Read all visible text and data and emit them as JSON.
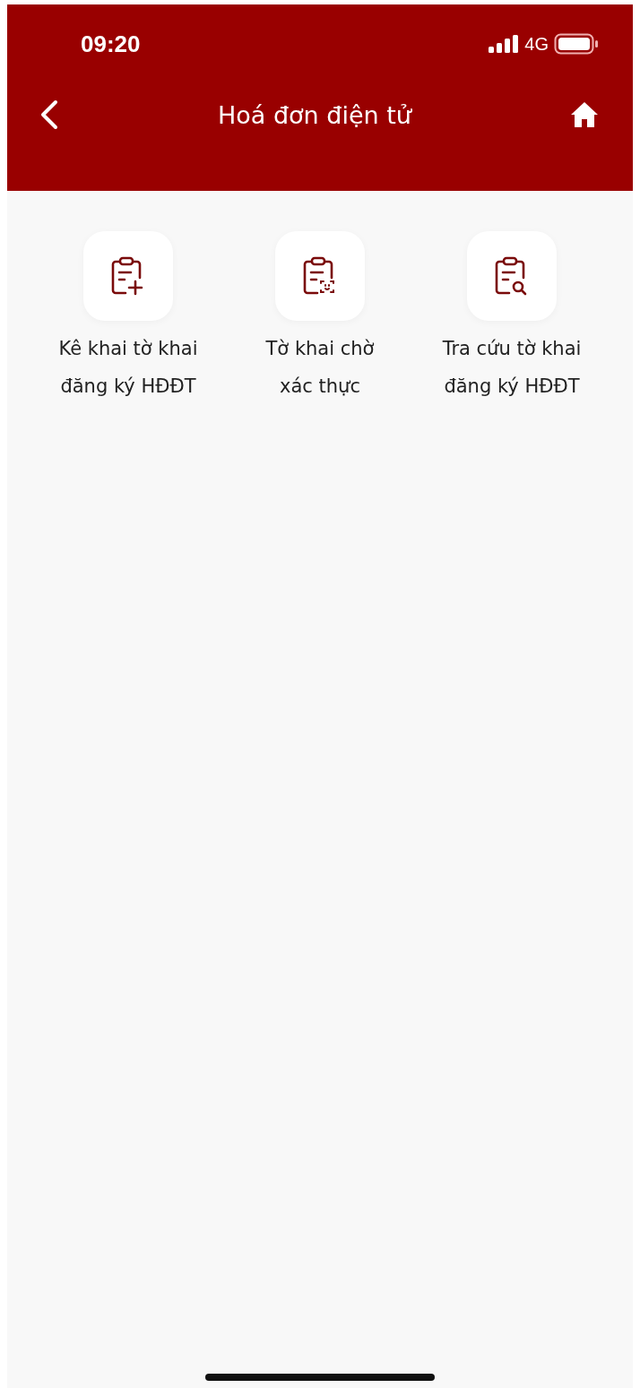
{
  "status_bar": {
    "time": "09:20",
    "network": "4G"
  },
  "header": {
    "title": "Hoá đơn điện tử"
  },
  "actions": [
    {
      "kind": "add",
      "label_lines": [
        "Kê khai tờ khai",
        "đăng ký HĐĐT"
      ]
    },
    {
      "kind": "face-scan",
      "label_lines": [
        "Tờ khai chờ",
        "xác thực"
      ]
    },
    {
      "kind": "search",
      "label_lines": [
        "Tra cứu tờ khai",
        "đăng ký HĐĐT"
      ]
    }
  ]
}
